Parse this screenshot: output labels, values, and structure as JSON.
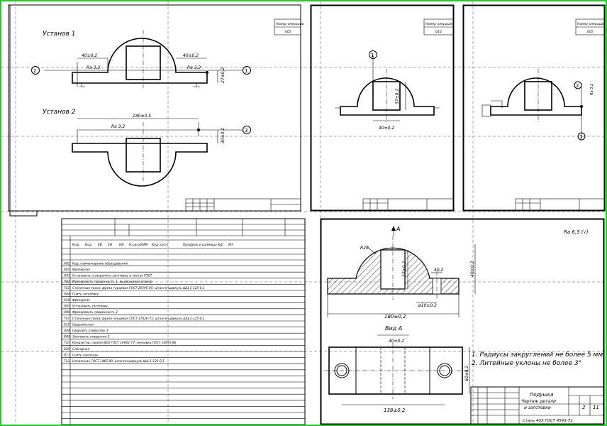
{
  "sheet1": {
    "corner_title": "Номер операции",
    "corner_value": "005",
    "setup1_label": "Установ 1",
    "setup2_label": "Установ 2",
    "dim_left": "40±0,2",
    "dim_right": "40±0,2",
    "dim_height": "27±0,2",
    "dim_width": "180±0,5",
    "dim_height2": "30±0,2",
    "rough1": "Ra 3,2",
    "rough2": "Ra 3,2",
    "rough3": "Ra 3,2",
    "marker_1": "1",
    "marker_2": "2",
    "marker_3": "3"
  },
  "sheet2": {
    "corner_title": "Номер операции",
    "corner_value": "010",
    "dim_height": "37±0,2",
    "dim_width": "40±0,2",
    "marker_1": "1"
  },
  "sheet3": {
    "corner_title": "Номер операции",
    "corner_value": "005",
    "marker_1": "1",
    "marker_2": "2",
    "rough": "Ra 3,2"
  },
  "route_card": {
    "header_labels": [
      "Код",
      "Код",
      "ЕВ",
      "ЕН",
      "КИ",
      "Н.расх",
      "КИМ",
      "Код загот",
      "Профиль и размеры",
      "КД",
      "МЗ"
    ],
    "rows": [
      {
        "code": "А01",
        "text": "Код, наименование оборудования"
      },
      {
        "code": "005",
        "text": "Фрезерная"
      },
      {
        "code": "О01",
        "text": "Установить и закрепить заготовку в тисках ГОСТ"
      },
      {
        "code": "О02",
        "text": "Фрезеровать поверхность 1, выдерживая размер"
      },
      {
        "code": "Т03",
        "text": "Станочные тиски; фреза торцевая ГОСТ 26595-85; штангенциркуль ШЦ-1-125-0,1"
      },
      {
        "code": "О04",
        "text": "Снять заготовку"
      },
      {
        "code": "010",
        "text": "Фрезерная"
      },
      {
        "code": "О05",
        "text": "Установить заготовку"
      },
      {
        "code": "О06",
        "text": "Фрезеровать поверхность 2"
      },
      {
        "code": "Т07",
        "text": "Станочные тиски; фреза концевая ГОСТ 17026-71; штангенциркуль ШЦ-1-125-0,1"
      },
      {
        "code": "015",
        "text": "Сверлильная"
      },
      {
        "code": "О08",
        "text": "Сверлить отверстие 3"
      },
      {
        "code": "О09",
        "text": "Зенковать отверстие 3"
      },
      {
        "code": "Т10",
        "text": "Кондуктор; сверло Ø10 ГОСТ 10902-77; зенковка ГОСТ 14953-80"
      },
      {
        "code": "020",
        "text": "Слесарная"
      },
      {
        "code": "О11",
        "text": "Снять заусенцы"
      },
      {
        "code": "Т12",
        "text": "Напильник ГОСТ 1465-80; штангенциркуль ШЦ-1-125-0,1"
      }
    ]
  },
  "part_drawing": {
    "roughness_note": "Ra 6,3 (√)",
    "section_mark": "А",
    "dim_r": "R20",
    "dim_h1": "37±0,2",
    "dim_h2": "40±0,2",
    "dim_small": "40,2",
    "dim_hole": "ø10±0,2",
    "dim_total": "180±0,2",
    "view_label": "Вид А",
    "dim_top": "40±0,2",
    "dim_side": "60±0,2",
    "dim_bottom": "138±0,2",
    "note1": "1. Радиусы закруглений не более 5 мм",
    "note2": "2. Литейные уклоны не более 3°",
    "title_name": "Подушка",
    "title_sub1": "Чертеж детали",
    "title_sub2": "и заготовки",
    "material": "Сталь 40Х ГОСТ 4543-71",
    "sheet_no": "2",
    "sheets_total": "11"
  }
}
